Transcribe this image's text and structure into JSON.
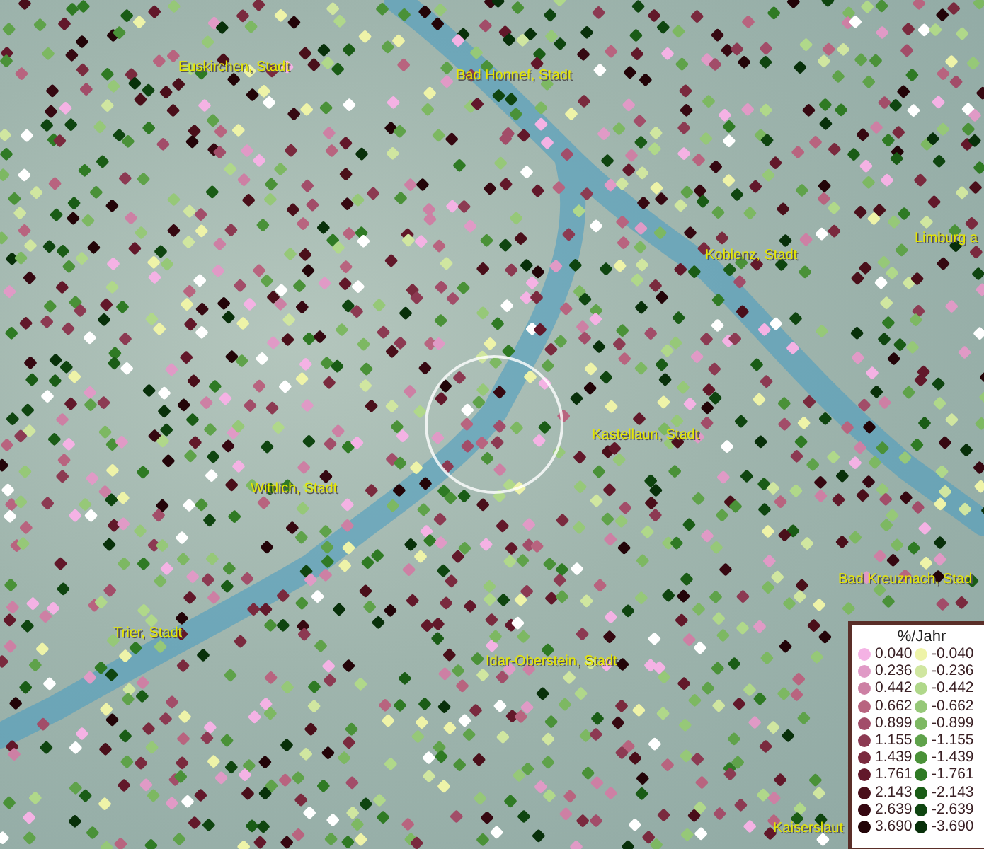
{
  "map": {
    "places": [
      {
        "label": "Euskirchen, Stadt"
      },
      {
        "label": "Bad Honnef, Stadt"
      },
      {
        "label": "Limburg a"
      },
      {
        "label": "Koblenz, Stadt"
      },
      {
        "label": "Kastellaun, Stadt"
      },
      {
        "label": "Wittlich, Stadt"
      },
      {
        "label": "Bad Kreuznach, Stad"
      },
      {
        "label": "Trier, Stadt"
      },
      {
        "label": "Idar-Oberstein, Stadt"
      },
      {
        "label": "Kaiserslaut"
      }
    ]
  },
  "legend": {
    "title": "%/Jahr",
    "entries": [
      {
        "label": "0.040",
        "color": "#f4b2e4"
      },
      {
        "label": "-0.040",
        "color": "#eef3a8"
      },
      {
        "label": "0.236",
        "color": "#e09ac6"
      },
      {
        "label": "-0.236",
        "color": "#d0e6a0"
      },
      {
        "label": "0.442",
        "color": "#cd80a4"
      },
      {
        "label": "-0.442",
        "color": "#b0d88a"
      },
      {
        "label": "0.662",
        "color": "#b8647f"
      },
      {
        "label": "-0.662",
        "color": "#96c878"
      },
      {
        "label": "0.899",
        "color": "#a24d69"
      },
      {
        "label": "-0.899",
        "color": "#7db862"
      },
      {
        "label": "1.155",
        "color": "#8c3a52"
      },
      {
        "label": "-1.155",
        "color": "#5fa24a"
      },
      {
        "label": "1.439",
        "color": "#7a2a3e"
      },
      {
        "label": "-1.439",
        "color": "#4a9138"
      },
      {
        "label": "1.761",
        "color": "#62182a"
      },
      {
        "label": "-1.761",
        "color": "#2f7a24"
      },
      {
        "label": "2.143",
        "color": "#4a0f1a"
      },
      {
        "label": "-2.143",
        "color": "#1a5c16"
      },
      {
        "label": "2.639",
        "color": "#360811"
      },
      {
        "label": "-2.639",
        "color": "#0f4510"
      },
      {
        "label": "3.690",
        "color": "#230408"
      },
      {
        "label": "-3.690",
        "color": "#08300a"
      }
    ]
  }
}
